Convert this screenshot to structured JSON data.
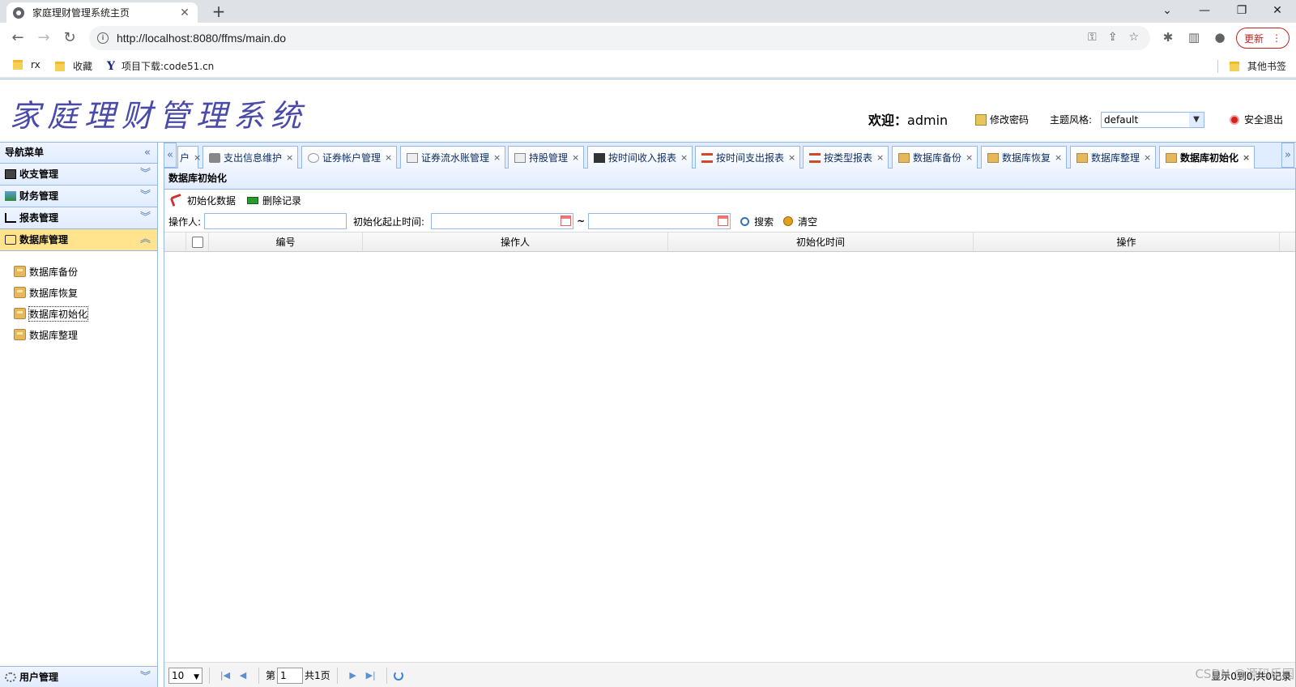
{
  "browser": {
    "tab_title": "家庭理财管理系统主页",
    "url": "http://localhost:8080/ffms/main.do",
    "update_label": "更新",
    "bookmarks": [
      "rx",
      "收藏",
      "项目下载:code51.cn"
    ],
    "other_bookmarks": "其他书签"
  },
  "header": {
    "logo": "家庭理财管理系统",
    "welcome_prefix": "欢迎：",
    "username": "admin",
    "change_password": "修改密码",
    "theme_label": "主题风格:",
    "theme_value": "default",
    "logout": "安全退出"
  },
  "sidebar": {
    "title": "导航菜单",
    "groups": [
      "收支管理",
      "财务管理",
      "报表管理",
      "数据库管理"
    ],
    "items": [
      "数据库备份",
      "数据库恢复",
      "数据库初始化",
      "数据库整理"
    ],
    "bottom_group": "用户管理"
  },
  "tabs": {
    "items": [
      "户",
      "支出信息维护",
      "证券帐户管理",
      "证券流水账管理",
      "持股管理",
      "按时间收入报表",
      "按时间支出报表",
      "按类型报表",
      "数据库备份",
      "数据库恢复",
      "数据库整理",
      "数据库初始化"
    ]
  },
  "panel": {
    "title": "数据库初始化",
    "init_label": "初始化数据",
    "delete_label": "删除记录",
    "operator_label": "操作人:",
    "time_label": "初始化起止时间:",
    "tilde": "~",
    "search_label": "搜索",
    "clear_label": "清空",
    "columns": [
      "编号",
      "操作人",
      "初始化时间",
      "操作"
    ]
  },
  "pager": {
    "page_size": "10",
    "page_prefix": "第",
    "page_value": "1",
    "page_total": "共1页",
    "info": "显示0到0,共0记录"
  },
  "watermark": "CSDN @源码乐园"
}
